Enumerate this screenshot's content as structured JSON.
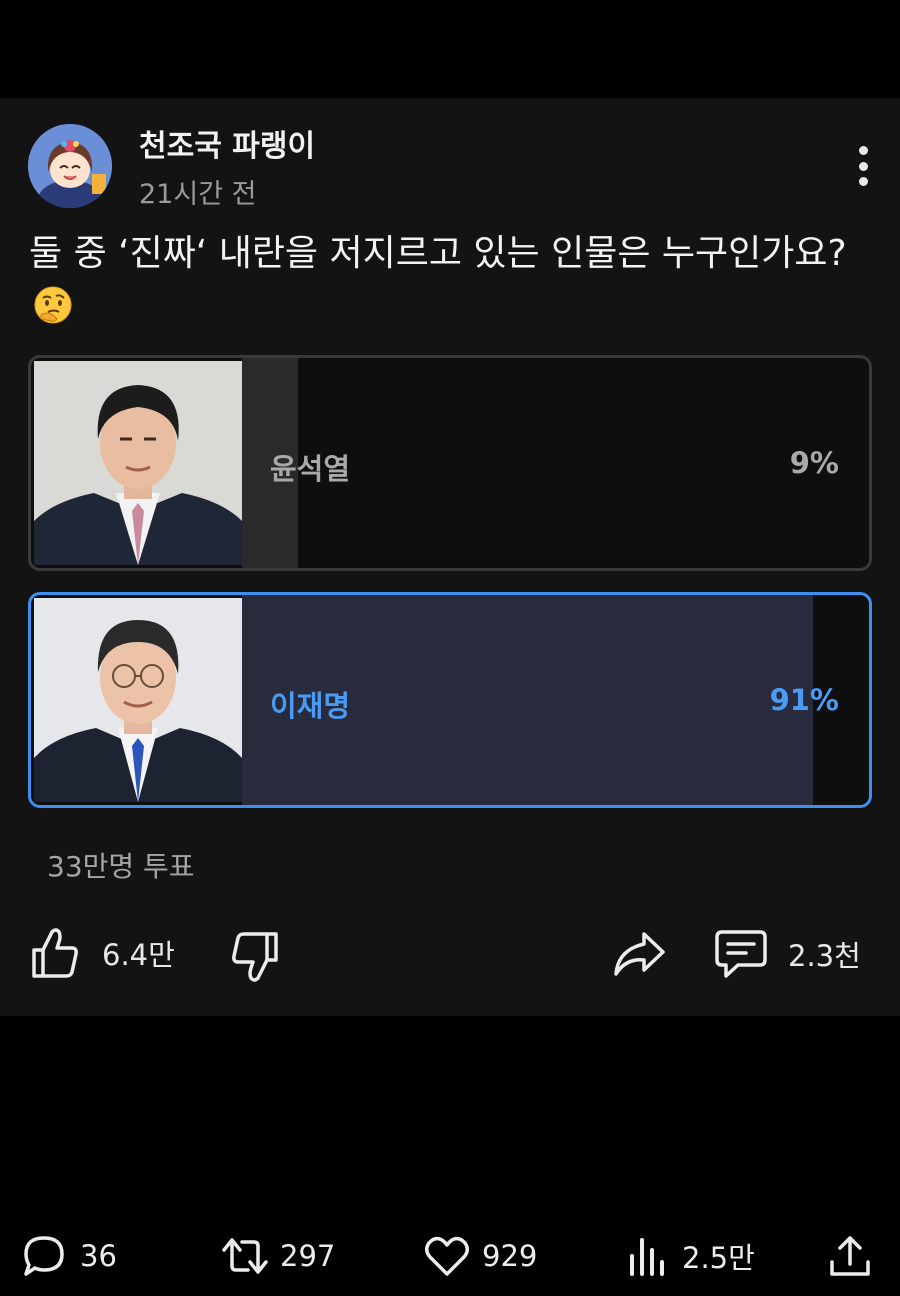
{
  "post": {
    "author": "천조국 파랭이",
    "time": "21시간 전",
    "question": "둘 중 ‘진짜‘ 내란을 저지르고 있는 인물은 누구인가요?",
    "emoji": "thinking-face-emoji"
  },
  "poll": {
    "options": [
      {
        "label": "윤석열",
        "percent_text": "9%",
        "percent": 9,
        "selected": false
      },
      {
        "label": "이재명",
        "percent_text": "91%",
        "percent": 91,
        "selected": true
      }
    ],
    "total_votes": "33만명 투표"
  },
  "actions": {
    "like_count": "6.4만",
    "comment_count": "2.3천"
  },
  "bottom_bar": {
    "replies": "36",
    "reposts": "297",
    "likes": "929",
    "views": "2.5만"
  },
  "colors": {
    "accent": "#4a9bf5",
    "card_bg": "#131313",
    "selected_fill": "#272b3b"
  },
  "icons": [
    "more-vertical-icon",
    "thumbs-up-icon",
    "thumbs-down-icon",
    "share-icon",
    "comment-icon",
    "reply-icon",
    "repost-icon",
    "heart-icon",
    "views-icon",
    "upload-icon"
  ]
}
